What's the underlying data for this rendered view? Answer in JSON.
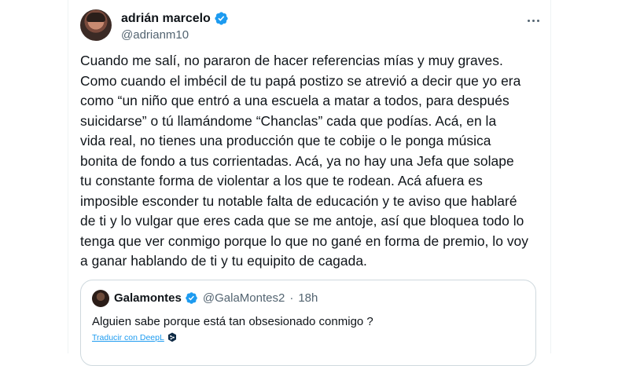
{
  "author": {
    "display_name": "adrián marcelo",
    "handle": "@adrianm10"
  },
  "tweet": {
    "text": "Cuando me salí, no pararon de hacer referencias mías y muy graves.\nComo cuando el imbécil de tu papá postizo se atrevió a decir que yo era\ncomo “un niño que entró a una escuela a matar a todos, para después\nsuicidarse” o tú llamándome “Chanclas” cada que podías. Acá, en la\nvida real, no tienes una producción que te cobije o le ponga música\nbonita de fondo a tus corrientadas. Acá, ya no hay una Jefa que solape\ntu constante forma de violentar a los que te rodean. Acá afuera es\nimposible esconder tu notable falta de educación y te aviso que hablaré\nde ti y lo vulgar que eres cada que se me antoje, así que bloquea todo lo\ntenga que ver conmigo porque lo que no gané en forma de premio, lo voy\na ganar hablando de ti y tu equipito de cagada."
  },
  "quote": {
    "display_name": "Galamontes",
    "handle": "@GalaMontes2",
    "separator": "·",
    "time": "18h",
    "text": "Alguien sabe porque está tan obsesionado conmigo ?",
    "translate_label": "Traducir con DeepL"
  },
  "icons": {
    "verified": "verified-badge-icon",
    "more": "more-options-icon",
    "deepl": "deepl-icon"
  },
  "colors": {
    "accent": "#1d9bf0",
    "text": "#0f1419",
    "secondary": "#536471",
    "border": "#cfd9de"
  }
}
